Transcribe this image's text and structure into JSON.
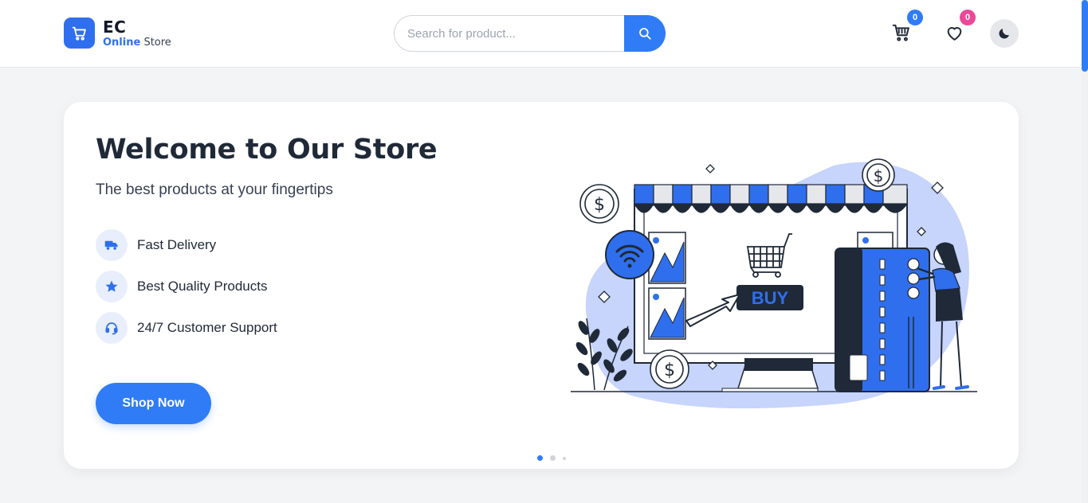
{
  "brand": {
    "name": "EC",
    "tagline_accent": "Online",
    "tagline_rest": "Store",
    "icon": "cart-icon"
  },
  "search": {
    "placeholder": "Search for product...",
    "button_icon": "search-icon"
  },
  "header": {
    "cart": {
      "icon": "cart-icon",
      "count": "0",
      "badge_color": "#2f7cf6"
    },
    "wishlist": {
      "icon": "heart-icon",
      "count": "0",
      "badge_color": "#ec4899"
    },
    "theme_toggle": {
      "icon": "moon-icon"
    }
  },
  "hero": {
    "title": "Welcome to Our Store",
    "subtitle": "The best products at your fingertips",
    "features": [
      {
        "label": "Fast Delivery",
        "icon": "truck-icon"
      },
      {
        "label": "Best Quality Products",
        "icon": "star-icon"
      },
      {
        "label": "24/7 Customer Support",
        "icon": "headset-icon"
      }
    ],
    "cta": "Shop Now",
    "illustration": {
      "buy_label": "BUY"
    },
    "carousel": {
      "slides": 3,
      "active": 1
    }
  },
  "colors": {
    "primary": "#2f7cf6",
    "pink": "#ec4899",
    "text": "#1f2937"
  }
}
